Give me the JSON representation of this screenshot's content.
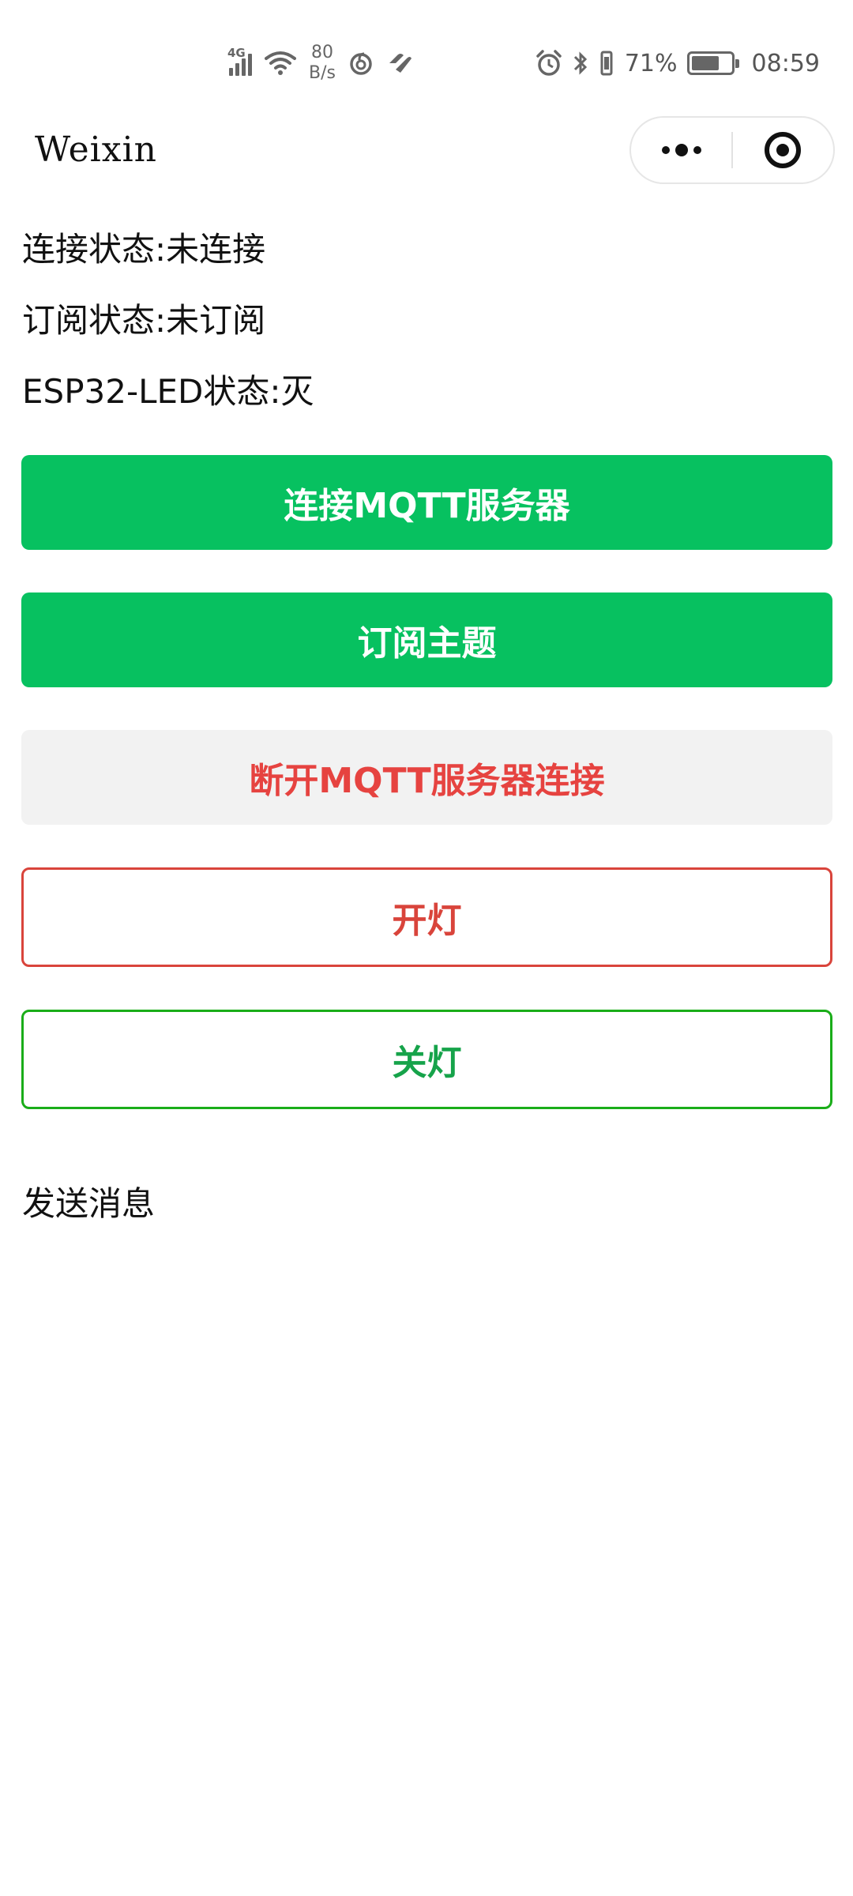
{
  "status_bar": {
    "network_type": "4G",
    "net_speed_value": "80",
    "net_speed_unit": "B/s",
    "battery_percent_text": "71%",
    "battery_level": 0.71,
    "time": "08:59",
    "icons": [
      "signal-icon",
      "wifi-icon",
      "netease-music-icon",
      "heart-app-icon",
      "alarm-icon",
      "bluetooth-icon",
      "vibrate-icon",
      "battery-icon"
    ]
  },
  "nav": {
    "title": "Weixin",
    "more_icon": "more-dots-icon",
    "close_icon": "miniprogram-close-icon"
  },
  "status": {
    "connection": "连接状态:未连接",
    "subscription": "订阅状态:未订阅",
    "led": "ESP32-LED状态:灭"
  },
  "buttons": {
    "connect": "连接MQTT服务器",
    "subscribe": "订阅主题",
    "disconnect": "断开MQTT服务器连接",
    "light_on": "开灯",
    "light_off": "关灯"
  },
  "send_message_label": "发送消息",
  "colors": {
    "primary_green": "#07c160",
    "warn_red": "#e64340",
    "plain_red_border": "#d9443b",
    "plain_green_border": "#1aad19",
    "default_bg": "#f2f2f2"
  }
}
